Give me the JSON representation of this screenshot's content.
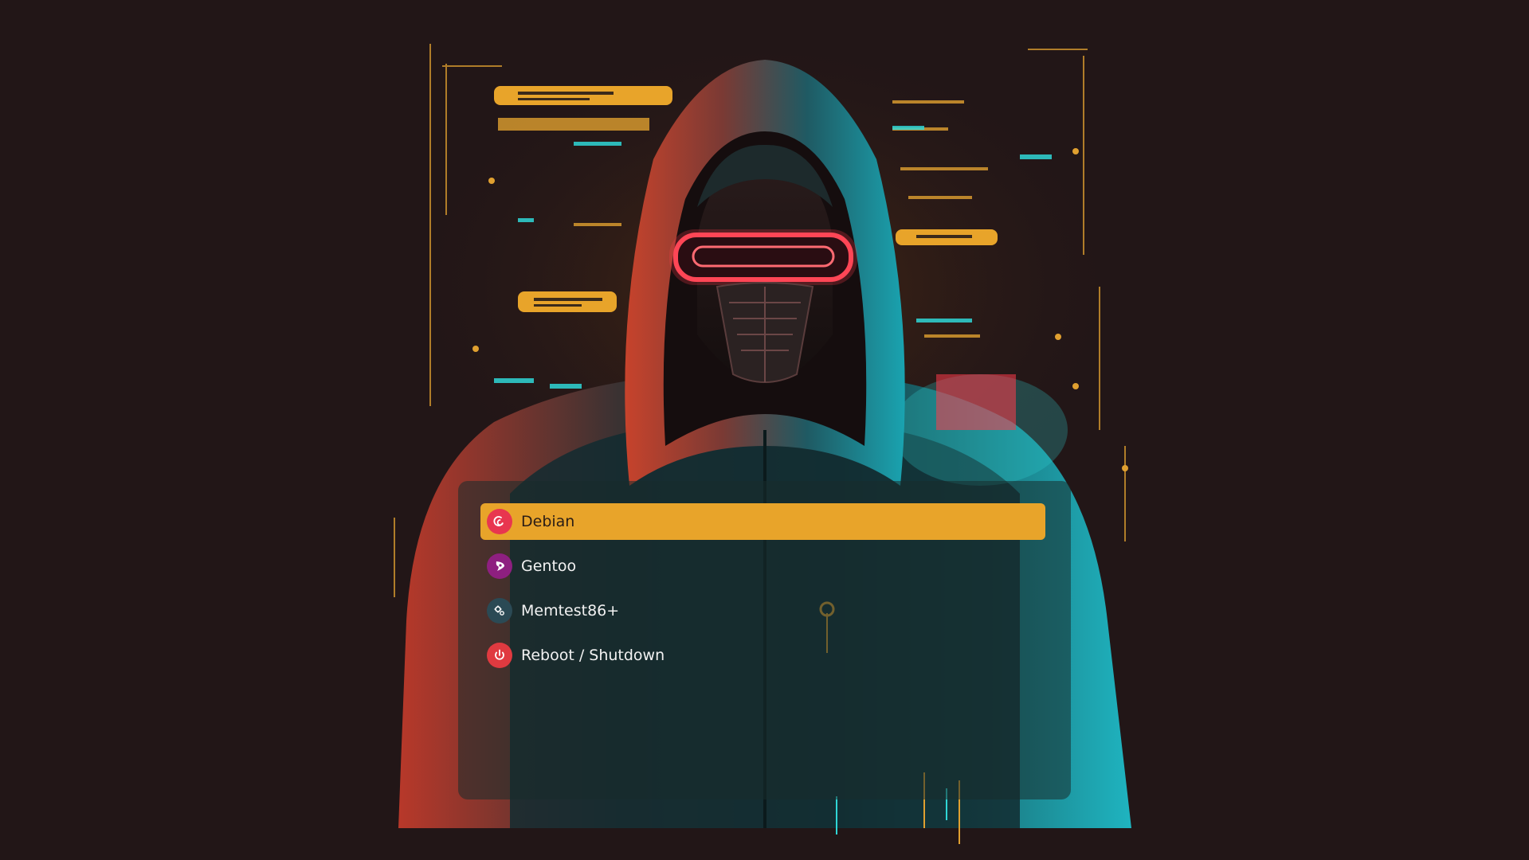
{
  "boot_menu": {
    "entries": [
      {
        "label": "Debian",
        "icon": "debian-swirl-icon",
        "selected": true,
        "icon_color": "#e8364f"
      },
      {
        "label": "Gentoo",
        "icon": "gentoo-icon",
        "selected": false,
        "icon_color": "#8e1f80"
      },
      {
        "label": "Memtest86+",
        "icon": "memtest-gear-icon",
        "selected": false,
        "icon_color": "#2b4a55"
      },
      {
        "label": "Reboot / Shutdown",
        "icon": "power-icon",
        "selected": false,
        "icon_color": "#e03a40"
      }
    ]
  },
  "colors": {
    "background": "#221617",
    "highlight": "#e8a42a",
    "neon_cyan": "#2fd6d6",
    "neon_red": "#ff3a4a",
    "amber": "#e0a030"
  },
  "wallpaper": {
    "subject": "hooded figure with glowing red visor and mask"
  }
}
